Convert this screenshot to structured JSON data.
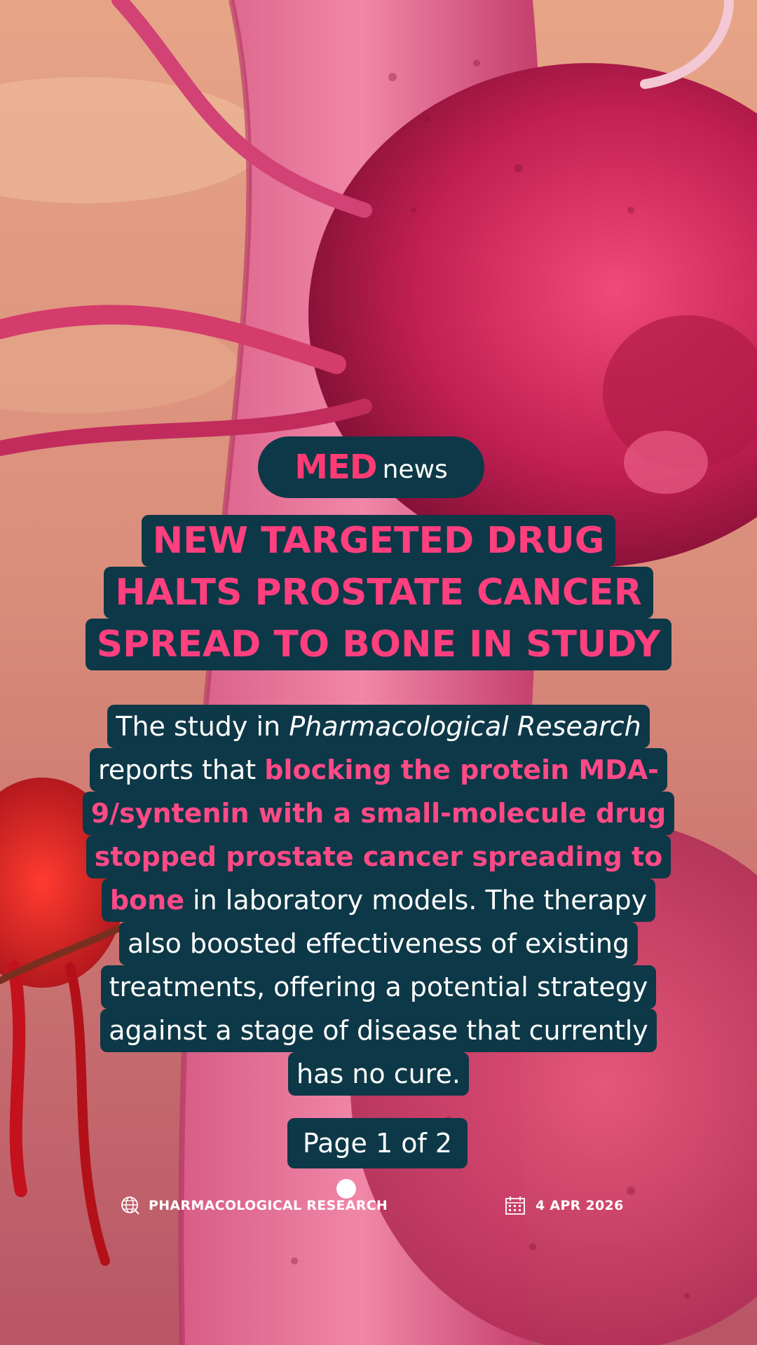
{
  "brand": {
    "name_primary": "MED",
    "name_secondary": "news"
  },
  "headline": {
    "lines": [
      "NEW TARGETED DRUG",
      "HALTS PROSTATE CANCER",
      "SPREAD TO BONE IN STUDY"
    ]
  },
  "body": {
    "l1_a": "The study in ",
    "l1_b": "Pharmacological Research",
    "l2_a": "reports that ",
    "l2_b": "blocking the protein MDA-",
    "l3": "9/syntenin with a small-molecule drug",
    "l4": "stopped prostate cancer spreading to",
    "l5_a": "bone",
    "l5_b": " in laboratory models. The therapy",
    "l6": "also boosted effectiveness of existing",
    "l7": "treatments, offering a potential strategy",
    "l8": "against a stage of disease that currently",
    "l9": "has no cure."
  },
  "pagination": {
    "label": "Page 1 of 2"
  },
  "footer": {
    "source_label": "PHARMACOLOGICAL RESEARCH",
    "source_icon": "globe-icon",
    "date_label": "4 APR 2026",
    "date_icon": "calendar-icon"
  },
  "colors": {
    "panel": "#0d3847",
    "accent": "#ff3f7e",
    "text": "#ffffff"
  }
}
